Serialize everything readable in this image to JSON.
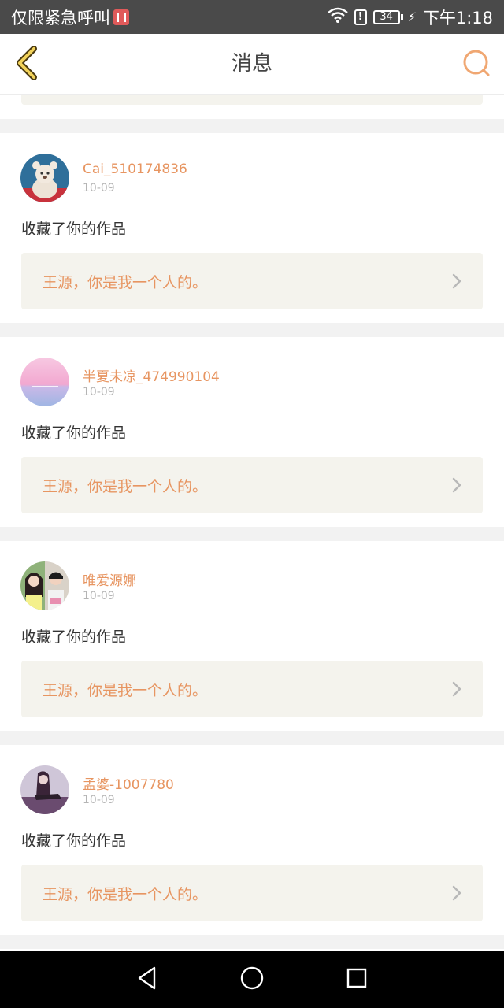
{
  "status_bar": {
    "carrier": "仅限紧急呼叫",
    "battery": "34",
    "time": "下午1:18"
  },
  "header": {
    "title": "消息"
  },
  "colors": {
    "accent": "#e79561",
    "link_bg": "#f4f3ed"
  },
  "messages": [
    {
      "username": "Cai_510174836",
      "date": "10-09",
      "action": "收藏了你的作品",
      "work_title": "王源，你是我一个人的。",
      "avatar": "teddy-bear"
    },
    {
      "username": "半夏未凉_474990104",
      "date": "10-09",
      "action": "收藏了你的作品",
      "work_title": "王源，你是我一个人的。",
      "avatar": "pink-sunset"
    },
    {
      "username": "唯爱源娜",
      "date": "10-09",
      "action": "收藏了你的作品",
      "work_title": "王源，你是我一个人的。",
      "avatar": "couple-photo"
    },
    {
      "username": "孟婆-1007780",
      "date": "10-09",
      "action": "收藏了你的作品",
      "work_title": "王源，你是我一个人的。",
      "avatar": "purple-figure"
    }
  ]
}
